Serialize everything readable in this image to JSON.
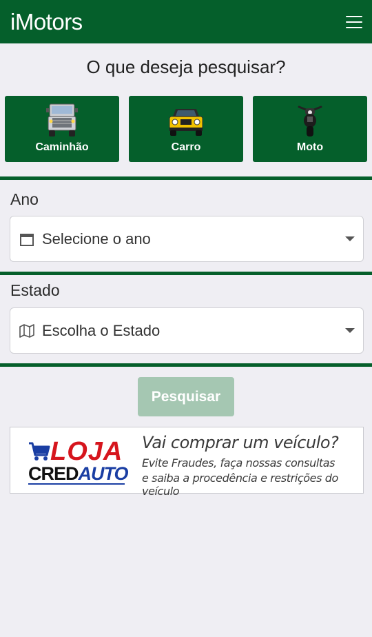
{
  "header": {
    "brand": "iMotors",
    "menu_icon": "hamburger-menu-icon"
  },
  "question": "O que deseja pesquisar?",
  "vehicle_types": [
    {
      "label": "Caminhão",
      "icon": "truck-icon"
    },
    {
      "label": "Carro",
      "icon": "car-icon"
    },
    {
      "label": "Moto",
      "icon": "motorcycle-icon"
    }
  ],
  "year": {
    "label": "Ano",
    "placeholder": "Selecione o ano",
    "icon": "calendar-icon"
  },
  "state": {
    "label": "Estado",
    "placeholder": "Escolha o Estado",
    "icon": "map-icon"
  },
  "search_button": "Pesquisar",
  "banner": {
    "logo_top": "LOJA",
    "logo_cred": "CRED",
    "logo_auto": "AUTO",
    "title": "Vai comprar um veículo?",
    "line1": "Evite Fraudes, faça nossas consultas",
    "line2": "e saiba a procedência e restrições do veículo"
  },
  "colors": {
    "primary": "#055f2b",
    "background": "#efeef3",
    "disabled_button": "#a5c7b2",
    "logo_red": "#d6151d",
    "logo_blue": "#1a3ea3"
  }
}
